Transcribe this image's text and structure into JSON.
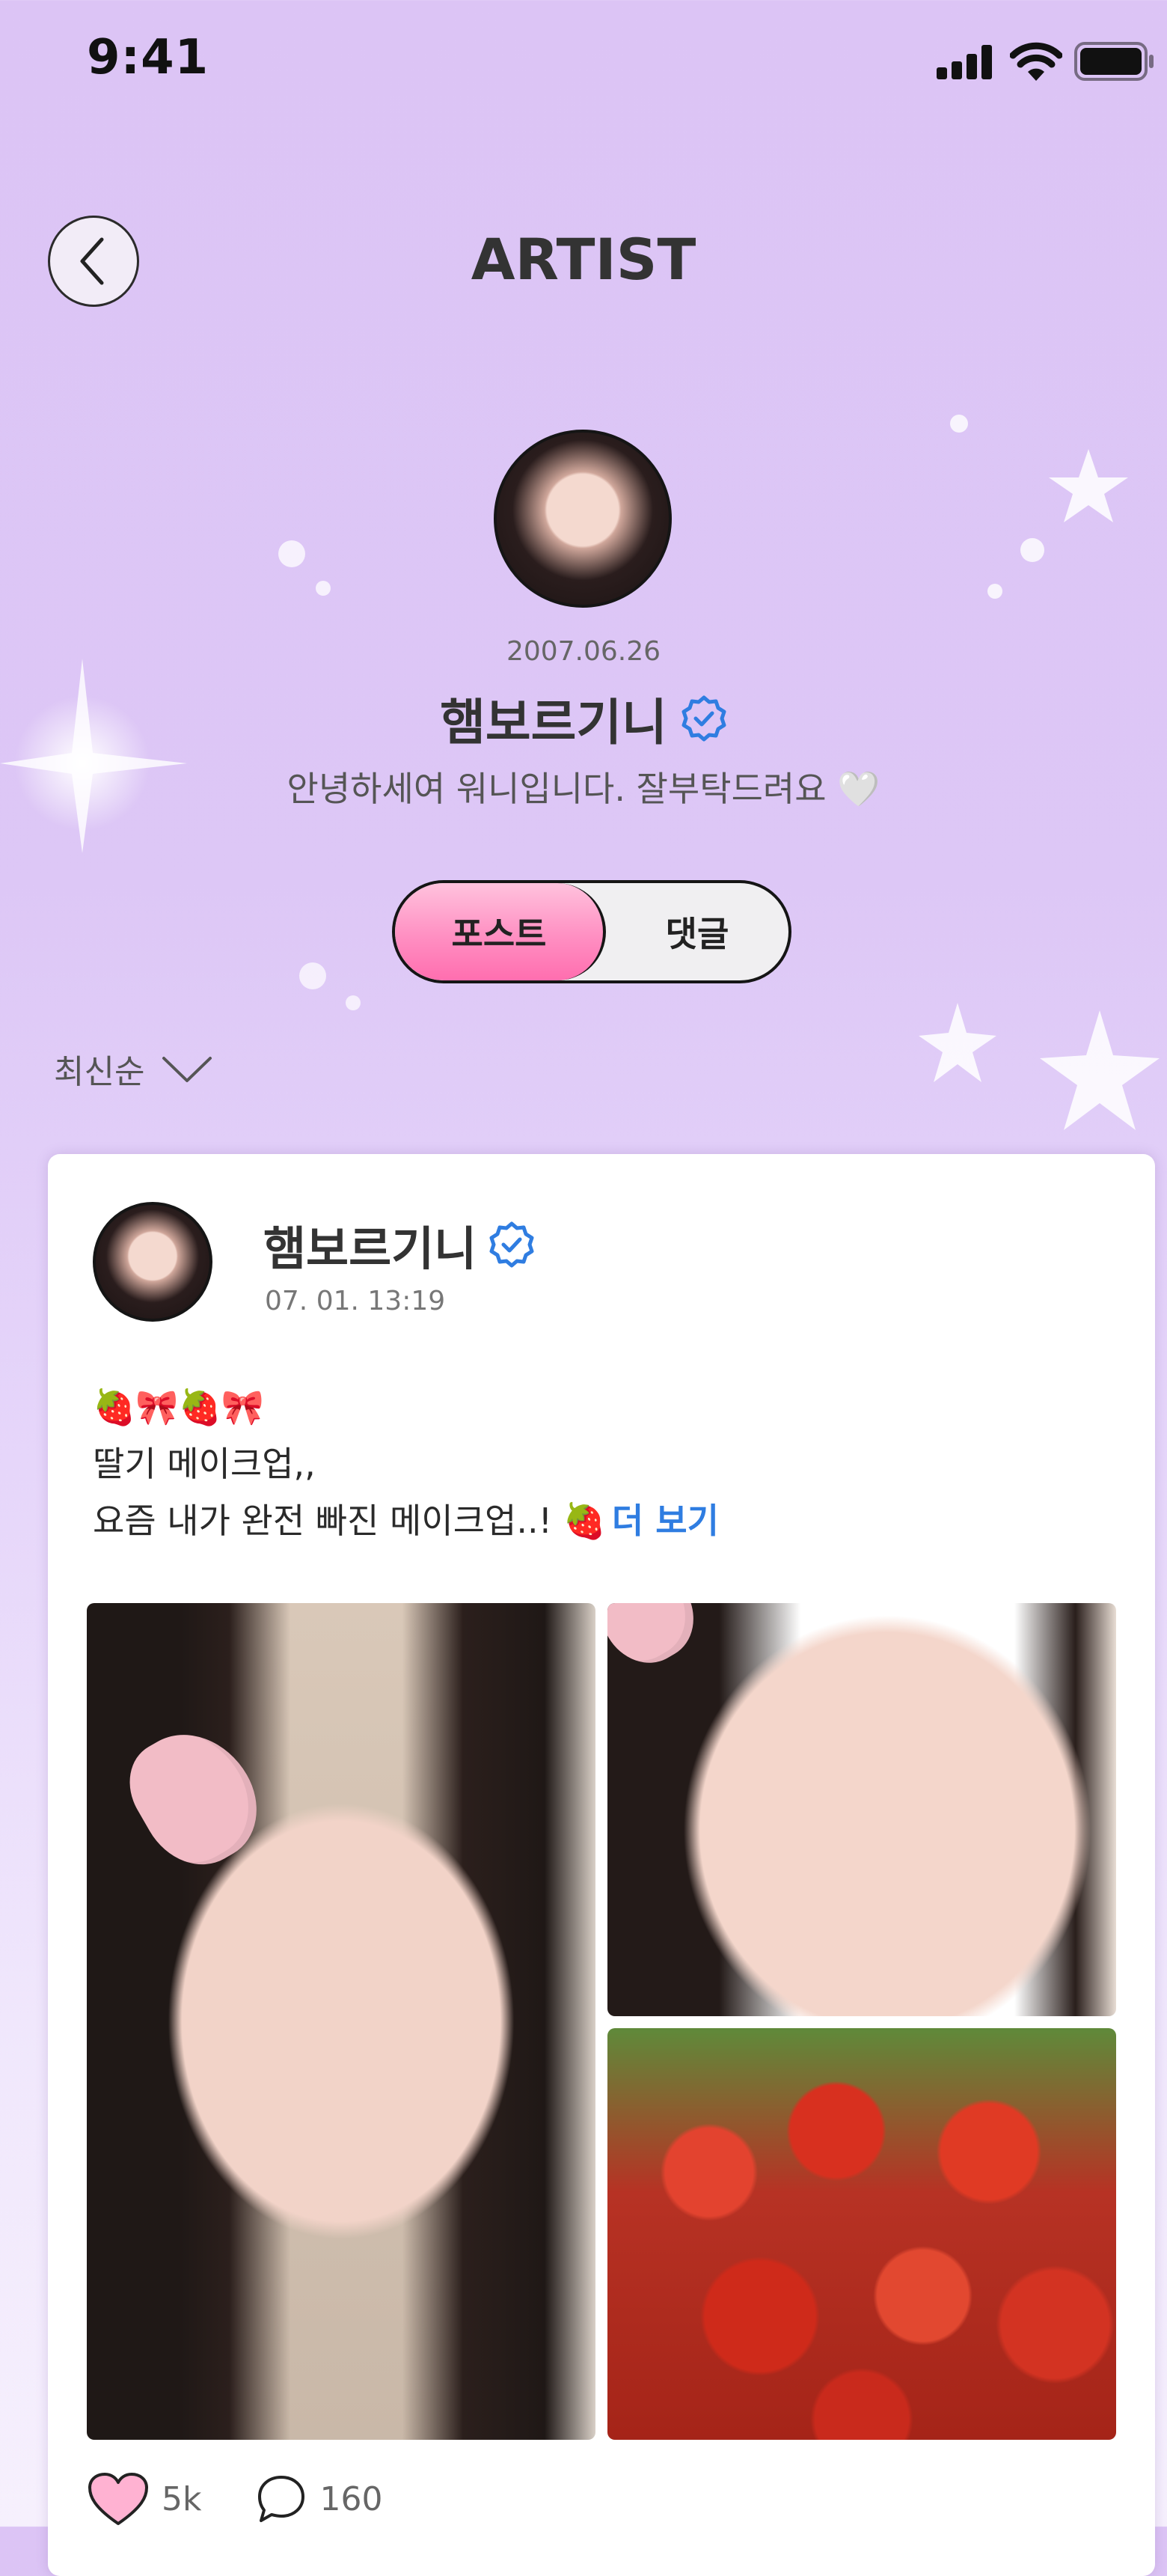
{
  "status_bar": {
    "time": "9:41"
  },
  "header": {
    "title": "ARTIST"
  },
  "profile": {
    "birthdate": "2007.06.26",
    "name": "햄보르기니",
    "bio": "안녕하세여 워니입니다. 잘부탁드려요 🤍"
  },
  "tabs": {
    "post": "포스트",
    "comment": "댓글"
  },
  "sort": {
    "label": "최신순"
  },
  "post": {
    "author": "햄보르기니",
    "timestamp": "07. 01. 13:19",
    "emoji_line": "🍓🎀🍓🎀",
    "line1": "딸기 메이크업,,",
    "line2": "요즘 내가 완전 빠진 메이크업..! 🍓",
    "more": "더 보기",
    "likes": "5k",
    "comments": "160"
  },
  "colors": {
    "accent_pink": "#ff8fc2",
    "verified_blue": "#2f7de1",
    "background": "#dcc4f5"
  }
}
